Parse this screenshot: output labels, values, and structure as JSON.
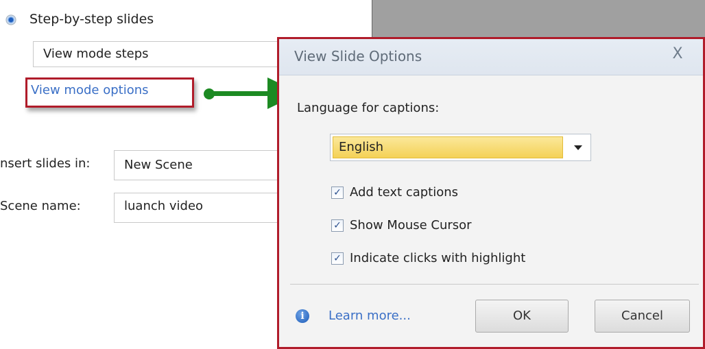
{
  "left_panel": {
    "radio_label": "Step-by-step slides",
    "view_mode_value": "View mode steps",
    "view_mode_options_link": "View mode options",
    "insert_label": "nsert slides in:",
    "insert_value": "New Scene",
    "scene_label": "Scene name:",
    "scene_value": "luanch video"
  },
  "dialog": {
    "title": "View Slide Options",
    "close_glyph": "X",
    "language_label": "Language for captions:",
    "language_selected": "English",
    "options": [
      {
        "label": "Add text captions",
        "checked": true
      },
      {
        "label": "Show Mouse Cursor",
        "checked": true
      },
      {
        "label": "Indicate clicks with highlight",
        "checked": true
      }
    ],
    "check_glyph": "✓",
    "info_glyph": "i",
    "learn_more": "Learn more...",
    "ok_label": "OK",
    "cancel_label": "Cancel"
  },
  "colors": {
    "highlight_border": "#b01c2a",
    "arrow": "#1c8a22",
    "link": "#3a6fc6",
    "selection": "#f4d156"
  }
}
